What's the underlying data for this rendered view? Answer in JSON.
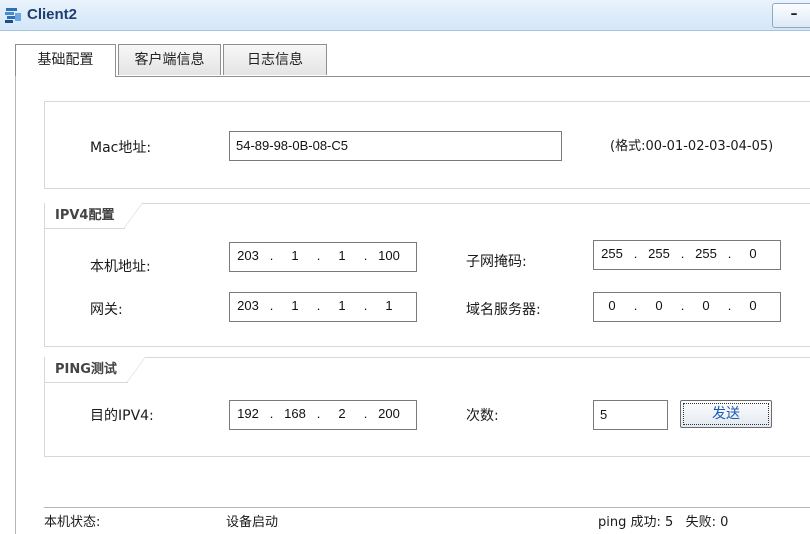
{
  "window": {
    "title": "Client2",
    "minimize": "–"
  },
  "tabs": [
    "基础配置",
    "客户端信息",
    "日志信息"
  ],
  "mac": {
    "label": "Mac地址:",
    "value": "54-89-98-0B-08-C5",
    "hint": "(格式:00-01-02-03-04-05)"
  },
  "ipv4": {
    "title": "IPV4配置",
    "host_label": "本机地址:",
    "host_ip": [
      "203",
      "1",
      "1",
      "100"
    ],
    "mask_label": "子网掩码:",
    "mask": [
      "255",
      "255",
      "255",
      "0"
    ],
    "gateway_label": "网关:",
    "gateway": [
      "203",
      "1",
      "1",
      "1"
    ],
    "dns_label": "域名服务器:",
    "dns": [
      "0",
      "0",
      "0",
      "0"
    ]
  },
  "ping": {
    "title": "PING测试",
    "target_label": "目的IPV4:",
    "target": [
      "192",
      "168",
      "2",
      "200"
    ],
    "count_label": "次数:",
    "count": "5",
    "send_label": "发送"
  },
  "status": {
    "label": "本机状态:",
    "value": "设备启动",
    "ping_result": "ping 成功: 5   失败: 0"
  }
}
